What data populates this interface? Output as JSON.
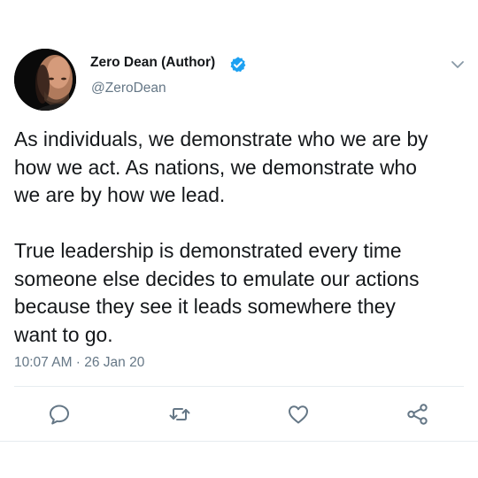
{
  "tweet": {
    "author_name": "Zero Dean (Author)",
    "author_handle": "@ZeroDean",
    "verified": true,
    "text_lines": [
      "As individuals, we demonstrate who we are by",
      "how we act. As nations, we demonstrate who",
      "we are by how we lead.",
      "",
      "True leadership is demonstrated every time",
      "someone else decides to emulate our actions",
      "because they see it leads somewhere they",
      "want to go."
    ],
    "timestamp": "10:07 AM · 26 Jan 20"
  },
  "actions": {
    "reply_icon": "reply-icon",
    "retweet_icon": "retweet-icon",
    "like_icon": "like-icon",
    "share_icon": "share-icon"
  },
  "icons": {
    "menu": "chevron-down-icon",
    "verified": "verified-badge-icon"
  },
  "colors": {
    "text_primary": "#14171a",
    "text_secondary": "#657786",
    "verified_blue": "#1da1f2",
    "divider": "#e6ecf0",
    "icon_gray": "#657786"
  }
}
